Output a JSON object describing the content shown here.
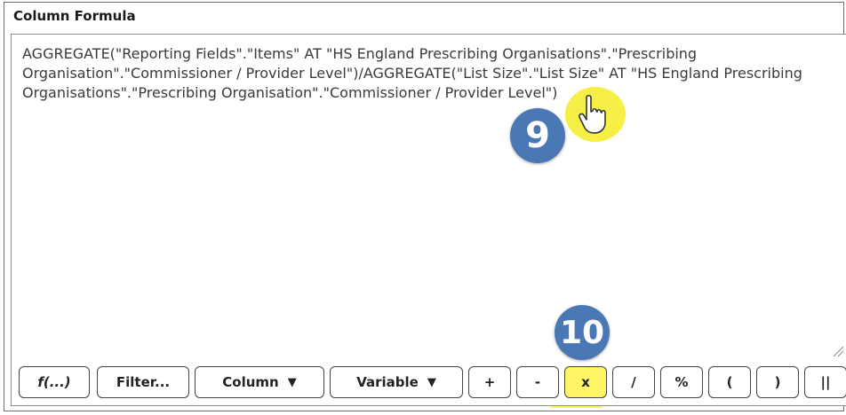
{
  "panel": {
    "title": "Column Formula"
  },
  "editor": {
    "formula": "AGGREGATE(\"Reporting Fields\".\"Items\" AT \"HS England Prescribing Organisations\".\"Prescribing Organisation\".\"Commissioner / Provider Level\")/AGGREGATE(\"List Size\".\"List Size\" AT \"HS England Prescribing Organisations\".\"Prescribing Organisation\".\"Commissioner / Provider Level\")"
  },
  "toolbar": {
    "function_label": "f(...)",
    "filter_label": "Filter...",
    "column_label": "Column",
    "variable_label": "Variable",
    "dropdown_caret": "▼",
    "plus_label": "+",
    "minus_label": "-",
    "times_label": "x",
    "divide_label": "/",
    "percent_label": "%",
    "open_paren_label": "(",
    "close_paren_label": ")",
    "concat_label": "||"
  },
  "annotations": {
    "step_9": "9",
    "step_10": "10",
    "badge_color": "#4a78b5",
    "highlight_color": "#fff566"
  },
  "icons": {
    "cursor": "hand-pointer-icon",
    "grip": "resize-grip-icon"
  }
}
